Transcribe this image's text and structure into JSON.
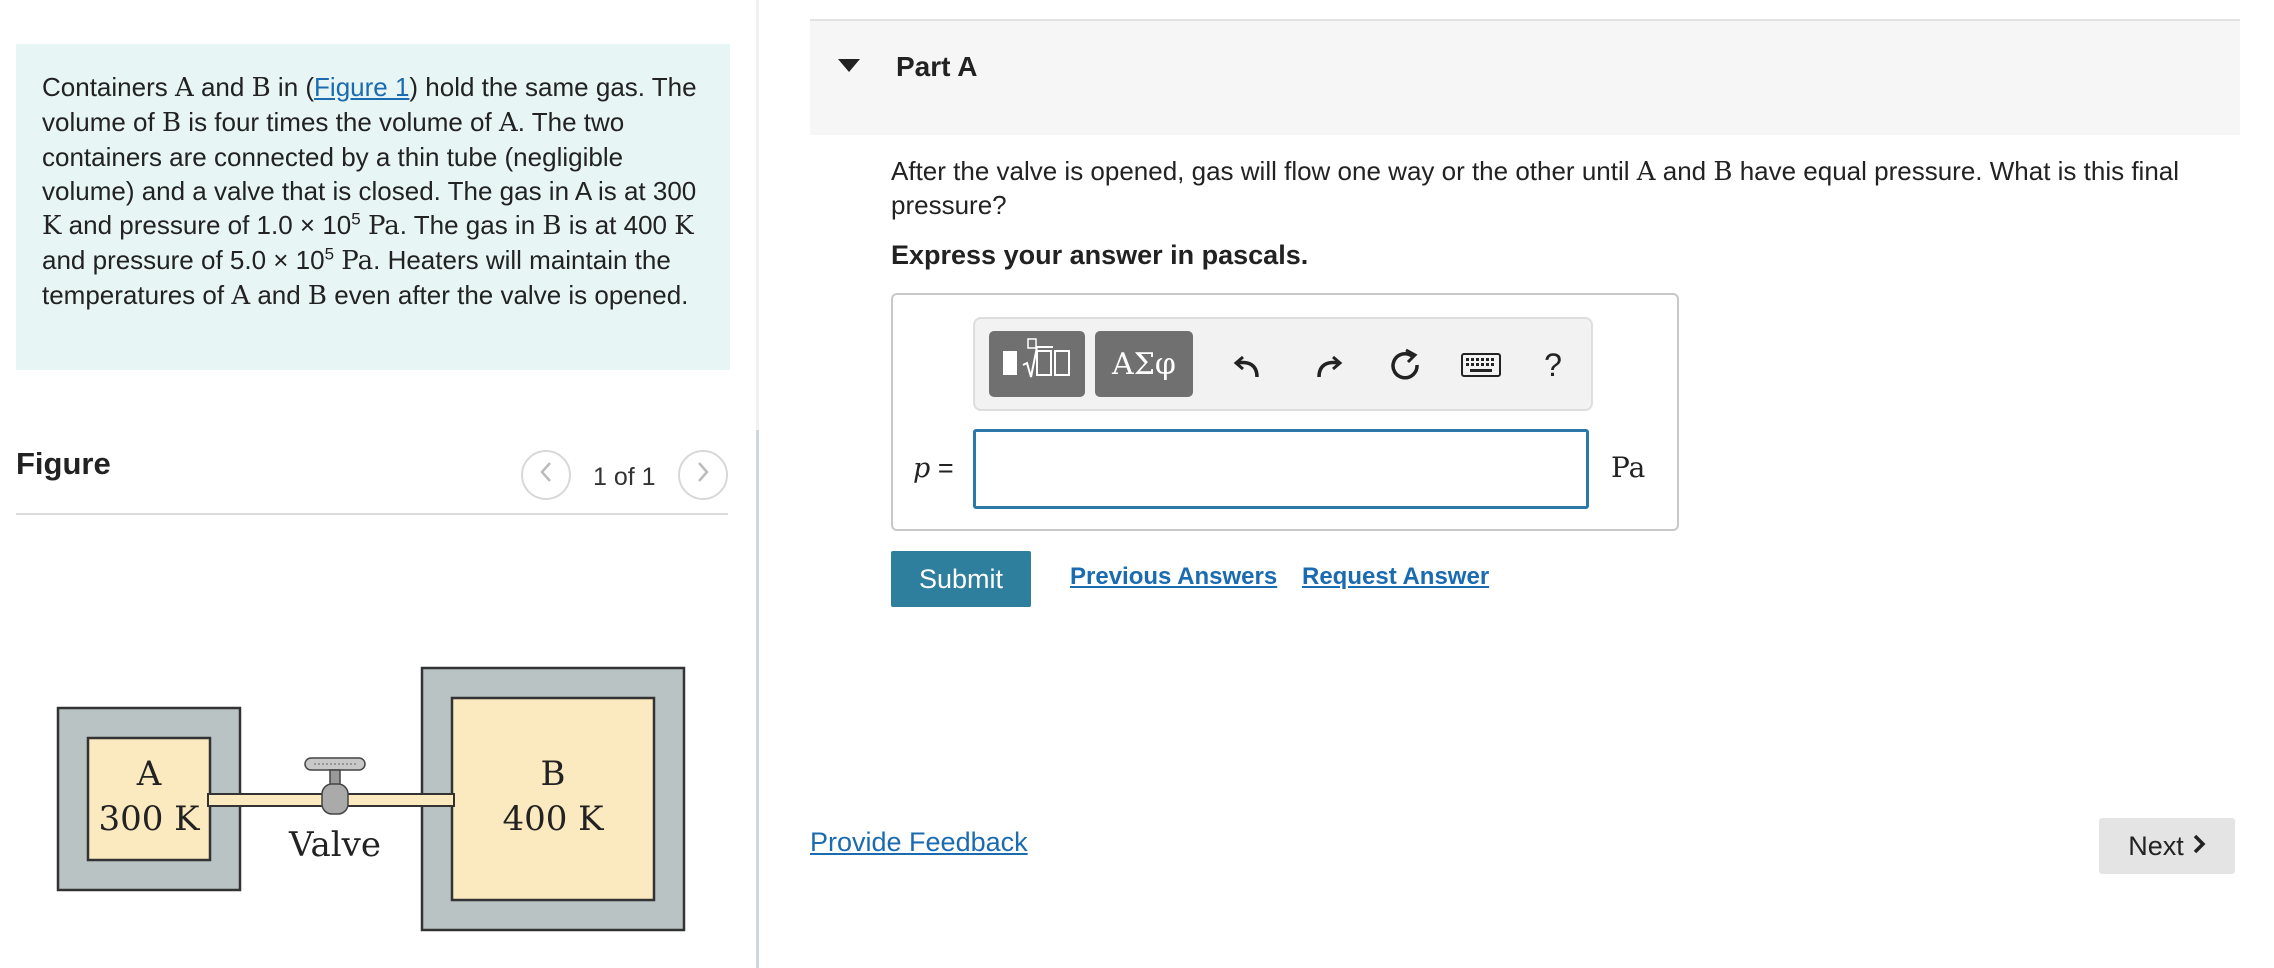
{
  "problem": {
    "text_1": "Containers ",
    "var_a": "A",
    "text_2": " and ",
    "var_b": "B",
    "text_3": " in (",
    "figure_link": "Figure 1",
    "text_4": ") hold the same gas. The volume of ",
    "text_5": " is four times the volume of ",
    "text_6": ". The two containers are connected by a thin tube (negligible volume) and a valve that is closed. The gas in A is at 300 ",
    "unit_k": "K",
    "text_7": " and pressure of 1.0 × 10",
    "exp": "5",
    "unit_pa": "Pa",
    "text_8": ". The gas in ",
    "text_9": " is at 400 ",
    "text_10": " and pressure of 5.0 × 10",
    "text_11": ". Heaters will maintain the temperatures of ",
    "text_12": " even after the valve is opened."
  },
  "figure": {
    "heading": "Figure",
    "counter": "1 of 1",
    "prev_icon": "chevron-left-icon",
    "next_icon": "chevron-right-icon",
    "container_a_label": "A",
    "container_a_temp": "300 K",
    "container_b_label": "B",
    "container_b_temp": "400 K",
    "valve_label": "Valve"
  },
  "part": {
    "title": "Part A",
    "question_1": "After the valve is opened, gas will flow one way or the other until ",
    "var_a": "A",
    "question_2": " and ",
    "var_b": "B",
    "question_3": " have equal pressure. What is this final pressure?",
    "instruction": "Express your answer in pascals."
  },
  "answer": {
    "toolbar": {
      "templates_icon": "templates-icon",
      "greek_label": "ΑΣφ",
      "undo_icon": "undo-icon",
      "redo_icon": "redo-icon",
      "reset_icon": "reset-icon",
      "keyboard_icon": "keyboard-icon",
      "help_label": "?"
    },
    "variable": "p",
    "equals": "=",
    "value": "",
    "unit": "Pa"
  },
  "actions": {
    "submit": "Submit",
    "previous_answers": "Previous Answers",
    "request_answer": "Request Answer"
  },
  "footer": {
    "feedback": "Provide Feedback",
    "next": "Next"
  },
  "colors": {
    "problem_bg": "#e8f5f5",
    "link": "#1a6bb0",
    "submit_bg": "#2e7e9e",
    "input_border": "#2c78a9",
    "diagram_fill_outer": "#b9c3c4",
    "diagram_fill_inner": "#fbe9c0"
  }
}
